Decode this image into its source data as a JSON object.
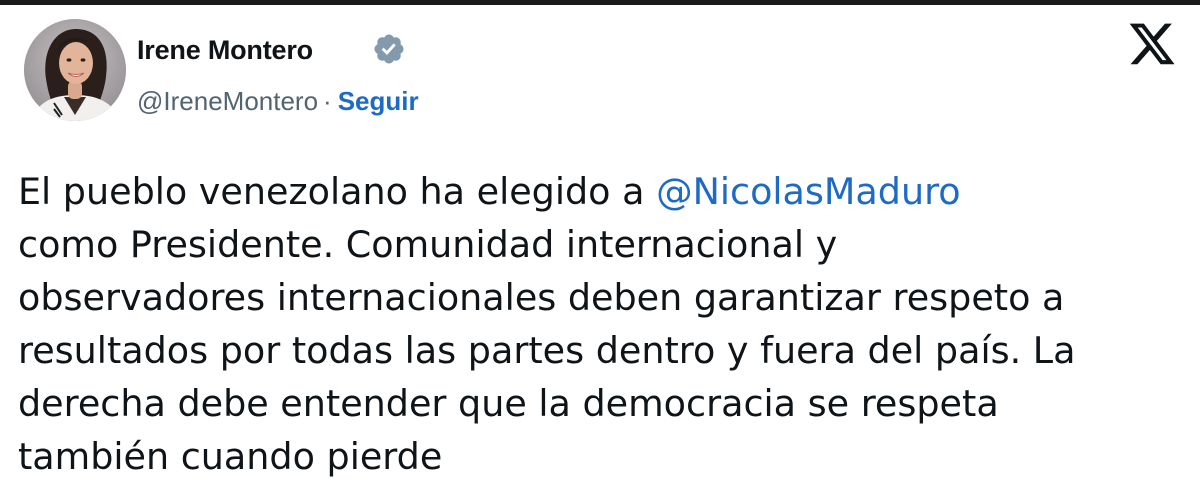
{
  "author": {
    "name": "Irene Montero",
    "handle": "@IreneMontero",
    "separator": "·",
    "follow_label": "Seguir",
    "verified_icon": "verified-badge-icon",
    "avatar": "profile-photo"
  },
  "platform": {
    "logo_icon": "x-logo-icon"
  },
  "tweet": {
    "line_1_pre": "El pueblo venezolano ha elegido a ",
    "mention": "@NicolasMaduro",
    "line_2": "como Presidente. Comunidad internacional y",
    "line_3": "observadores internacionales deben garantizar respeto a",
    "line_4": "resultados por todas las partes dentro y fuera del país. La",
    "line_5": "derecha debe entender que la democracia se respeta",
    "line_6": "también cuando pierde"
  },
  "colors": {
    "text": "#0f1419",
    "secondary": "#536471",
    "link": "#1d6bc6",
    "badge": "#829aab"
  }
}
